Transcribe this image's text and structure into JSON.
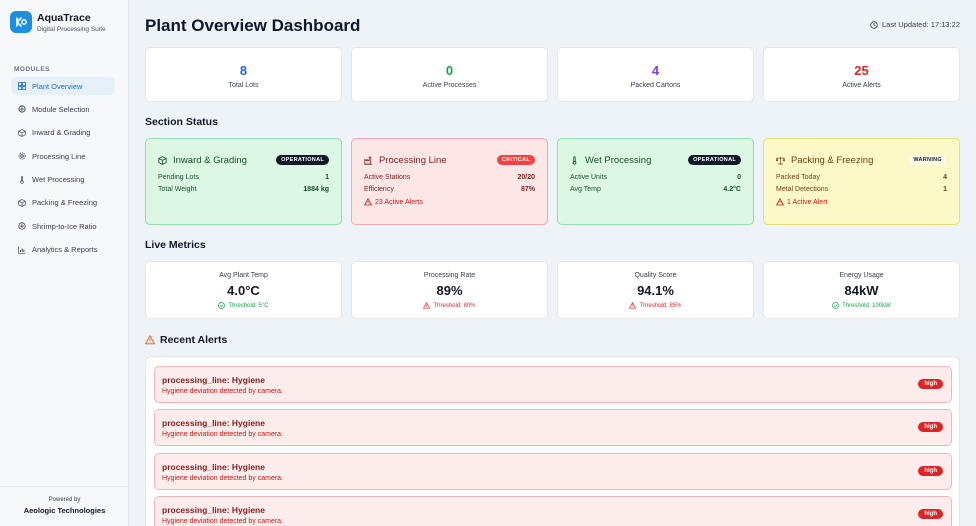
{
  "brand": {
    "name": "AquaTrace",
    "subtitle": "Digital Processing Suite"
  },
  "sidebar": {
    "section_label": "MODULES",
    "items": [
      {
        "label": "Plant Overview",
        "icon": "grid-icon",
        "active": true
      },
      {
        "label": "Module Selection",
        "icon": "modules-icon"
      },
      {
        "label": "Inward & Grading",
        "icon": "box-icon"
      },
      {
        "label": "Processing Line",
        "icon": "gear-icon"
      },
      {
        "label": "Wet Processing",
        "icon": "thermometer-icon"
      },
      {
        "label": "Packing & Freezing",
        "icon": "package-icon"
      },
      {
        "label": "Shrimp-to-Ice Ratio",
        "icon": "ratio-icon"
      },
      {
        "label": "Analytics & Reports",
        "icon": "bar-chart-icon"
      }
    ],
    "footer": {
      "powered_by": "Powered by",
      "company": "Aeologic Technologies"
    }
  },
  "header": {
    "title": "Plant Overview Dashboard",
    "last_updated": "Last Updated: 17:13:22"
  },
  "stats": [
    {
      "value": "8",
      "label": "Total Lots",
      "color": "#2563eb"
    },
    {
      "value": "0",
      "label": "Active Processes",
      "color": "#16a34a"
    },
    {
      "value": "4",
      "label": "Packed Cartons",
      "color": "#7c3aed"
    },
    {
      "value": "25",
      "label": "Active Alerts",
      "color": "#dc2626"
    }
  ],
  "section_status": {
    "heading": "Section Status",
    "cards": [
      {
        "title": "Inward & Grading",
        "status": "OPERATIONAL",
        "rows": [
          {
            "label": "Pending Lots",
            "value": "1"
          },
          {
            "label": "Total Weight",
            "value": "1884 kg"
          }
        ]
      },
      {
        "title": "Processing Line",
        "status": "CRITICAL",
        "rows": [
          {
            "label": "Active Stations",
            "value": "20/20"
          },
          {
            "label": "Efficiency",
            "value": "87%"
          }
        ],
        "alert": "23 Active Alerts"
      },
      {
        "title": "Wet Processing",
        "status": "OPERATIONAL",
        "rows": [
          {
            "label": "Active Units",
            "value": "0"
          },
          {
            "label": "Avg Temp",
            "value": "4.2°C"
          }
        ]
      },
      {
        "title": "Packing & Freezing",
        "status": "WARNING",
        "rows": [
          {
            "label": "Packed Today",
            "value": "4"
          },
          {
            "label": "Metal Detections",
            "value": "1"
          }
        ],
        "alert": "1 Active Alert"
      }
    ]
  },
  "live_metrics": {
    "heading": "Live Metrics",
    "items": [
      {
        "label": "Avg Plant Temp",
        "value": "4.0°C",
        "threshold": "Threshold: 5°C",
        "ok": true
      },
      {
        "label": "Processing Rate",
        "value": "89%",
        "threshold": "Threshold: 80%",
        "ok": false
      },
      {
        "label": "Quality Score",
        "value": "94.1%",
        "threshold": "Threshold: 85%",
        "ok": false
      },
      {
        "label": "Energy Usage",
        "value": "84kW",
        "threshold": "Threshold: 100kW",
        "ok": true
      }
    ]
  },
  "recent_alerts": {
    "heading": "Recent Alerts",
    "items": [
      {
        "title": "processing_line: Hygiene",
        "desc": "Hygiene deviation detected by camera.",
        "severity": "high"
      },
      {
        "title": "processing_line: Hygiene",
        "desc": "Hygiene deviation detected by camera.",
        "severity": "high"
      },
      {
        "title": "processing_line: Hygiene",
        "desc": "Hygiene deviation detected by camera.",
        "severity": "high"
      },
      {
        "title": "processing_line: Hygiene",
        "desc": "Hygiene deviation detected by camera.",
        "severity": "high"
      }
    ]
  }
}
